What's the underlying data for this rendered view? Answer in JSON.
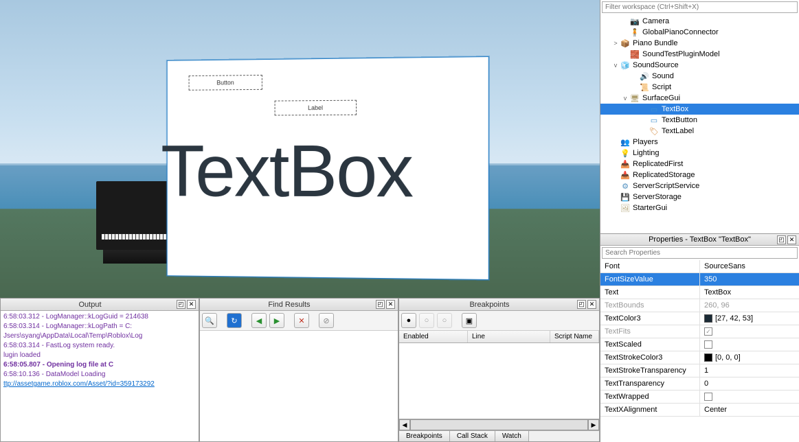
{
  "viewport": {
    "gui_button_label": "Button",
    "gui_label_label": "Label",
    "gui_textbox_text": "TextBox"
  },
  "panels": {
    "output": {
      "title": "Output",
      "lines": [
        {
          "t": "6:58:03.312",
          "m": " - LogManager::kLogGuid = 214638"
        },
        {
          "t": "6:58:03.314",
          "m": " - LogManager::kLogPath = C:"
        },
        {
          "t": "",
          "m": "Jsers\\syang\\AppData\\Local\\Temp\\Roblox\\Log"
        },
        {
          "t": "6:58:03.314",
          "m": " - FastLog system ready."
        },
        {
          "t": "",
          "m": "lugin loaded"
        },
        {
          "t": "6:58:05.807",
          "m": " - Opening log file at C",
          "bold": true
        },
        {
          "t": "6:58:10.136",
          "m": " - DataModel Loading"
        },
        {
          "link": "ttp://assetgame.roblox.com/Asset/?id=359173292"
        }
      ]
    },
    "find": {
      "title": "Find Results"
    },
    "breakpoints": {
      "title": "Breakpoints",
      "columns": [
        "Enabled",
        "Line",
        "Script Name"
      ],
      "tabs": [
        "Breakpoints",
        "Call Stack",
        "Watch"
      ]
    }
  },
  "explorer": {
    "search_placeholder": "Filter workspace (Ctrl+Shift+X)",
    "items": [
      {
        "indent": 2,
        "icon": "📷",
        "label": "Camera",
        "color": "#3080d0"
      },
      {
        "indent": 2,
        "icon": "🧍",
        "label": "GlobalPianoConnector",
        "color": "#c0a040"
      },
      {
        "indent": 1,
        "arrow": ">",
        "icon": "📦",
        "label": "Piano Bundle",
        "color": "#c06050"
      },
      {
        "indent": 2,
        "icon": "🧱",
        "label": "SoundTestPluginModel",
        "color": "#a09080"
      },
      {
        "indent": 1,
        "arrow": "v",
        "icon": "🧊",
        "label": "SoundSource",
        "color": "#a0a0a0"
      },
      {
        "indent": 3,
        "icon": "🔊",
        "label": "Sound",
        "color": "#808080"
      },
      {
        "indent": 3,
        "icon": "📜",
        "label": "Script",
        "color": "#4080c0"
      },
      {
        "indent": 2,
        "arrow": "v",
        "icon": "🖥",
        "label": "SurfaceGui",
        "color": "#b0a070"
      },
      {
        "indent": 4,
        "icon": "▭",
        "label": "TextBox",
        "selected": true,
        "color": "#4090d0"
      },
      {
        "indent": 4,
        "icon": "▭",
        "label": "TextButton",
        "color": "#4090d0"
      },
      {
        "indent": 4,
        "icon": "🏷",
        "label": "TextLabel",
        "color": "#d08030"
      },
      {
        "indent": 1,
        "icon": "👥",
        "label": "Players",
        "color": "#d0b040"
      },
      {
        "indent": 1,
        "icon": "💡",
        "label": "Lighting",
        "color": "#e0c040"
      },
      {
        "indent": 1,
        "icon": "📥",
        "label": "ReplicatedFirst",
        "color": "#c05040"
      },
      {
        "indent": 1,
        "icon": "📥",
        "label": "ReplicatedStorage",
        "color": "#c05040"
      },
      {
        "indent": 1,
        "icon": "⚙",
        "label": "ServerScriptService",
        "color": "#5090c0"
      },
      {
        "indent": 1,
        "icon": "💾",
        "label": "ServerStorage",
        "color": "#5090c0"
      },
      {
        "indent": 1,
        "icon": "🖼",
        "label": "StarterGui",
        "color": "#b0a070"
      }
    ]
  },
  "properties": {
    "title": "Properties - TextBox \"TextBox\"",
    "search_placeholder": "Search Properties",
    "rows": [
      {
        "name": "Font",
        "val": "SourceSans"
      },
      {
        "name": "FontSizeValue",
        "val": "350",
        "selected": true
      },
      {
        "name": "Text",
        "val": "TextBox"
      },
      {
        "name": "TextBounds",
        "val": "260, 96",
        "readonly": true
      },
      {
        "name": "TextColor3",
        "val": "[27, 42, 53]",
        "swatch": "#1b2a35"
      },
      {
        "name": "TextFits",
        "val": "",
        "check": true,
        "readonly": true
      },
      {
        "name": "TextScaled",
        "val": "",
        "check": false
      },
      {
        "name": "TextStrokeColor3",
        "val": "[0, 0, 0]",
        "swatch": "#000000"
      },
      {
        "name": "TextStrokeTransparency",
        "val": "1"
      },
      {
        "name": "TextTransparency",
        "val": "0"
      },
      {
        "name": "TextWrapped",
        "val": "",
        "check": false
      },
      {
        "name": "TextXAlignment",
        "val": "Center"
      }
    ]
  }
}
